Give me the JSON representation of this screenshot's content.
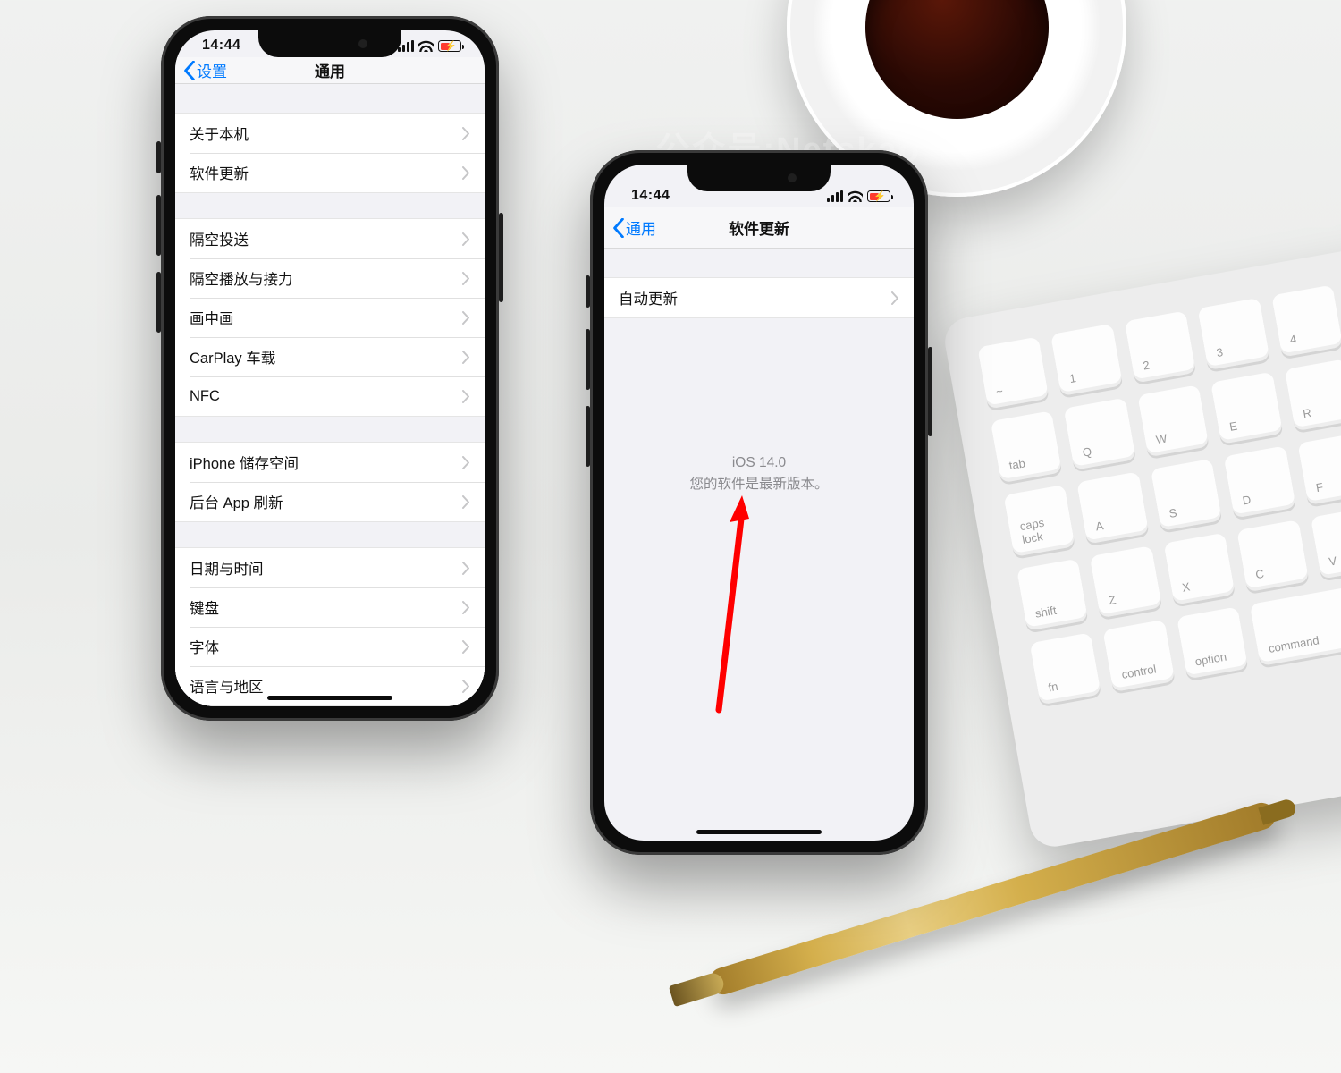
{
  "watermark": "公众号:Netskao",
  "status": {
    "time": "14:44"
  },
  "phone1": {
    "nav": {
      "back": "设置",
      "title": "通用"
    },
    "group1": [
      "关于本机",
      "软件更新"
    ],
    "group2": [
      "隔空投送",
      "隔空播放与接力",
      "画中画",
      "CarPlay 车载",
      "NFC"
    ],
    "group3": [
      "iPhone 储存空间",
      "后台 App 刷新"
    ],
    "group4": [
      "日期与时间",
      "键盘",
      "字体",
      "语言与地区"
    ]
  },
  "phone2": {
    "nav": {
      "back": "通用",
      "title": "软件更新"
    },
    "group1": [
      "自动更新"
    ],
    "message": {
      "version": "iOS 14.0",
      "text": "您的软件是最新版本。"
    }
  },
  "keyboard_keys": [
    "~",
    "1",
    "2",
    "3",
    "tab",
    "Q",
    "W",
    "caps lock",
    "A",
    "S",
    "shift",
    "Z",
    "X",
    "fn",
    "control",
    "option",
    "command"
  ]
}
